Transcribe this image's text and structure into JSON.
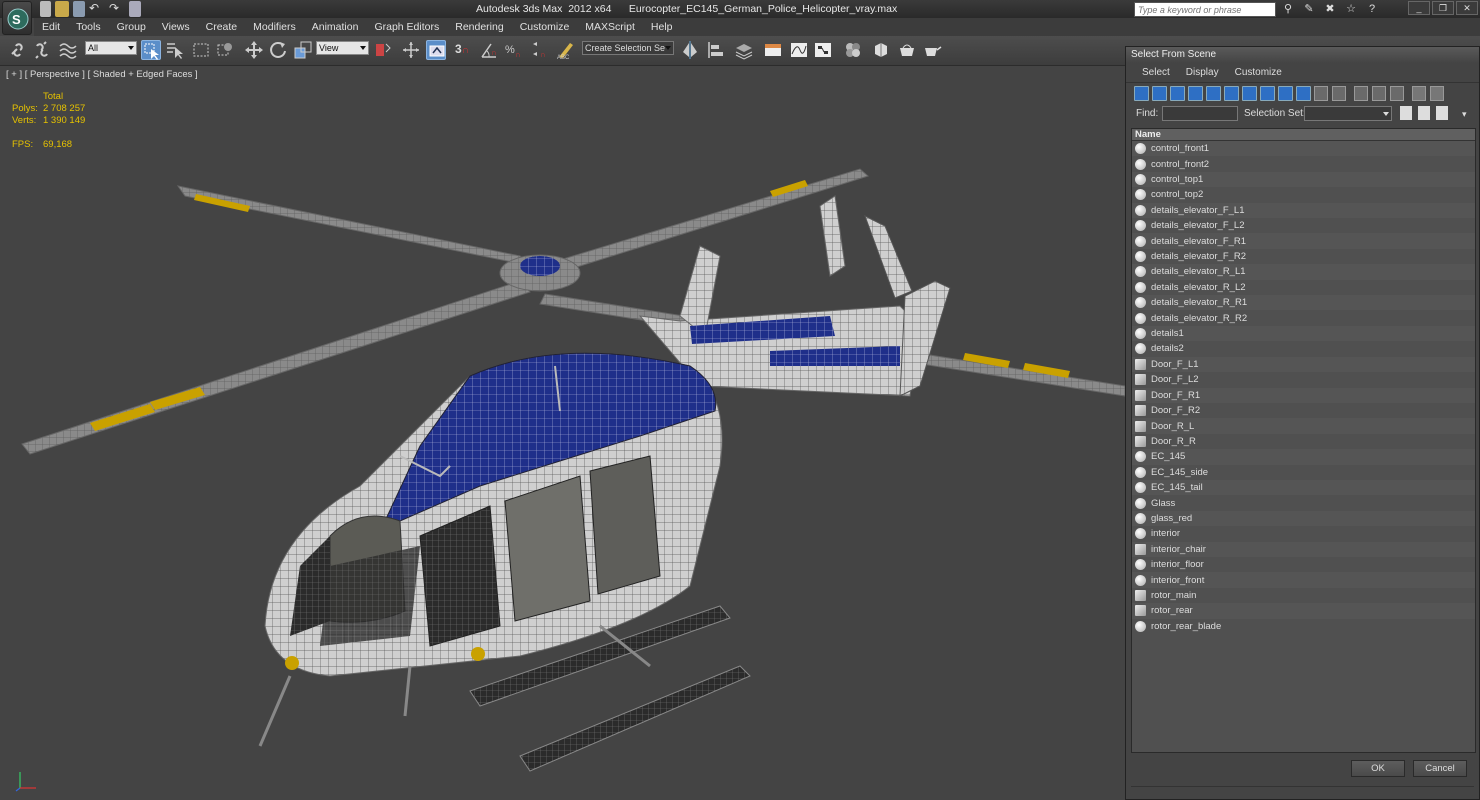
{
  "title_bar": {
    "title": "Autodesk 3ds Max  2012 x64      Eurocopter_EC145_German_Police_Helicopter_vray.max",
    "search_placeholder": "Type a keyword or phrase"
  },
  "menu": [
    "Edit",
    "Tools",
    "Group",
    "Views",
    "Create",
    "Modifiers",
    "Animation",
    "Graph Editors",
    "Rendering",
    "Customize",
    "MAXScript",
    "Help"
  ],
  "toolbar": {
    "filter_value": "All",
    "ref_coord_value": "View",
    "selection_set_value": "Create Selection Se",
    "snap_label": "3"
  },
  "viewport": {
    "label": "[ + ] [ Perspective ] [ Shaded + Edged Faces ]",
    "stats": {
      "total_label": "Total",
      "polys_label": "Polys:",
      "polys_value": "2 708 257",
      "verts_label": "Verts:",
      "verts_value": "1 390 149",
      "fps_label": "FPS:",
      "fps_value": "69,168"
    }
  },
  "dialog": {
    "title": "Select From Scene",
    "menu": [
      "Select",
      "Display",
      "Customize"
    ],
    "find_label": "Find:",
    "selection_set_label": "Selection Set:",
    "column_name": "Name",
    "items": [
      {
        "name": "control_front1",
        "icon": "geometry"
      },
      {
        "name": "control_front2",
        "icon": "geometry"
      },
      {
        "name": "control_top1",
        "icon": "geometry"
      },
      {
        "name": "control_top2",
        "icon": "geometry"
      },
      {
        "name": "details_elevator_F_L1",
        "icon": "geometry"
      },
      {
        "name": "details_elevator_F_L2",
        "icon": "geometry"
      },
      {
        "name": "details_elevator_F_R1",
        "icon": "geometry"
      },
      {
        "name": "details_elevator_F_R2",
        "icon": "geometry"
      },
      {
        "name": "details_elevator_R_L1",
        "icon": "geometry"
      },
      {
        "name": "details_elevator_R_L2",
        "icon": "geometry"
      },
      {
        "name": "details_elevator_R_R1",
        "icon": "geometry"
      },
      {
        "name": "details_elevator_R_R2",
        "icon": "geometry"
      },
      {
        "name": "details1",
        "icon": "geometry"
      },
      {
        "name": "details2",
        "icon": "geometry"
      },
      {
        "name": "Door_F_L1",
        "icon": "group"
      },
      {
        "name": "Door_F_L2",
        "icon": "group"
      },
      {
        "name": "Door_F_R1",
        "icon": "group"
      },
      {
        "name": "Door_F_R2",
        "icon": "group"
      },
      {
        "name": "Door_R_L",
        "icon": "group"
      },
      {
        "name": "Door_R_R",
        "icon": "group"
      },
      {
        "name": "EC_145",
        "icon": "geometry"
      },
      {
        "name": "EC_145_side",
        "icon": "geometry"
      },
      {
        "name": "EC_145_tail",
        "icon": "geometry"
      },
      {
        "name": "Glass",
        "icon": "geometry"
      },
      {
        "name": "glass_red",
        "icon": "geometry"
      },
      {
        "name": "interior",
        "icon": "geometry"
      },
      {
        "name": "interior_chair",
        "icon": "group"
      },
      {
        "name": "interior_floor",
        "icon": "geometry"
      },
      {
        "name": "interior_front",
        "icon": "geometry"
      },
      {
        "name": "rotor_main",
        "icon": "group"
      },
      {
        "name": "rotor_rear",
        "icon": "group"
      },
      {
        "name": "rotor_rear_blade",
        "icon": "geometry"
      }
    ],
    "ok_label": "OK",
    "cancel_label": "Cancel"
  },
  "colors": {
    "viewport_bg": "#444444",
    "stats_text": "#e6c200",
    "active_tool": "#5b8ec9",
    "heli_blue": "#1f2f8a"
  }
}
